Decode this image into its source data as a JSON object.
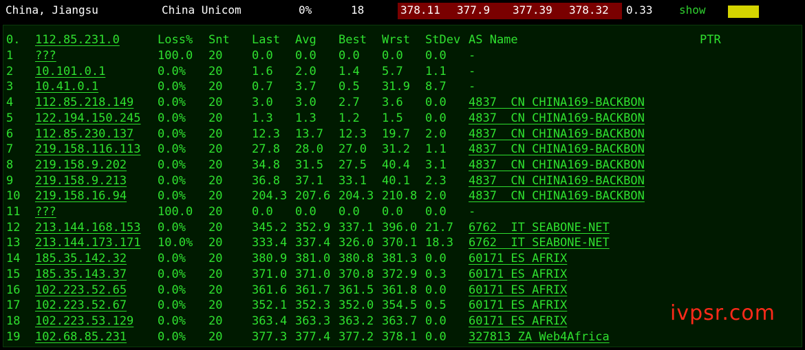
{
  "summary": {
    "location": "China, Jiangsu",
    "isp": "China Unicom",
    "loss": "0%",
    "sent": "18",
    "last": "378.11",
    "avg": "377.9",
    "best": "377.39",
    "worst": "378.32",
    "stdev": "0.33",
    "show_label": "show",
    "highlight_color": "#7a0000",
    "indicator_color": "#d4d400"
  },
  "headers": {
    "hop": "0.",
    "host": "112.85.231.0",
    "loss": "Loss%",
    "snt": "Snt",
    "last": "Last",
    "avg": "Avg",
    "best": "Best",
    "wrst": "Wrst",
    "stdev": "StDev",
    "asname": "AS Name",
    "ptr": "PTR"
  },
  "hops": [
    {
      "n": "1",
      "host": "???",
      "loss": "100.0",
      "snt": "20",
      "last": "0.0",
      "avg": "0.0",
      "best": "0.0",
      "wrst": "0.0",
      "stdev": "0.0",
      "as": "-"
    },
    {
      "n": "2",
      "host": "10.101.0.1",
      "loss": "0.0%",
      "snt": "20",
      "last": "1.6",
      "avg": "2.0",
      "best": "1.4",
      "wrst": "5.7",
      "stdev": "1.1",
      "as": "-"
    },
    {
      "n": "3",
      "host": "10.41.0.1",
      "loss": "0.0%",
      "snt": "20",
      "last": "0.7",
      "avg": "3.7",
      "best": "0.5",
      "wrst": "31.9",
      "stdev": "8.7",
      "as": "-"
    },
    {
      "n": "4",
      "host": "112.85.218.149",
      "loss": "0.0%",
      "snt": "20",
      "last": "3.0",
      "avg": "3.0",
      "best": "2.7",
      "wrst": "3.6",
      "stdev": "0.0",
      "as": "4837  CN CHINA169-BACKBON"
    },
    {
      "n": "5",
      "host": "122.194.150.245",
      "loss": "0.0%",
      "snt": "20",
      "last": "1.3",
      "avg": "1.3",
      "best": "1.2",
      "wrst": "1.5",
      "stdev": "0.0",
      "as": "4837  CN CHINA169-BACKBON"
    },
    {
      "n": "6",
      "host": "112.85.230.137",
      "loss": "0.0%",
      "snt": "20",
      "last": "12.3",
      "avg": "13.7",
      "best": "12.3",
      "wrst": "19.7",
      "stdev": "2.0",
      "as": "4837  CN CHINA169-BACKBON"
    },
    {
      "n": "7",
      "host": "219.158.116.113",
      "loss": "0.0%",
      "snt": "20",
      "last": "27.8",
      "avg": "28.0",
      "best": "27.0",
      "wrst": "31.2",
      "stdev": "1.1",
      "as": "4837  CN CHINA169-BACKBON"
    },
    {
      "n": "8",
      "host": "219.158.9.202",
      "loss": "0.0%",
      "snt": "20",
      "last": "34.8",
      "avg": "31.5",
      "best": "27.5",
      "wrst": "40.4",
      "stdev": "3.1",
      "as": "4837  CN CHINA169-BACKBON"
    },
    {
      "n": "9",
      "host": "219.158.9.213",
      "loss": "0.0%",
      "snt": "20",
      "last": "36.8",
      "avg": "37.1",
      "best": "33.1",
      "wrst": "40.1",
      "stdev": "2.3",
      "as": "4837  CN CHINA169-BACKBON"
    },
    {
      "n": "10",
      "host": "219.158.16.94",
      "loss": "0.0%",
      "snt": "20",
      "last": "204.3",
      "avg": "207.6",
      "best": "204.3",
      "wrst": "210.8",
      "stdev": "2.0",
      "as": "4837  CN CHINA169-BACKBON"
    },
    {
      "n": "11",
      "host": "???",
      "loss": "100.0",
      "snt": "20",
      "last": "0.0",
      "avg": "0.0",
      "best": "0.0",
      "wrst": "0.0",
      "stdev": "0.0",
      "as": "-"
    },
    {
      "n": "12",
      "host": "213.144.168.153",
      "loss": "0.0%",
      "snt": "20",
      "last": "345.2",
      "avg": "352.9",
      "best": "337.1",
      "wrst": "396.0",
      "stdev": "21.7",
      "as": "6762  IT SEABONE-NET"
    },
    {
      "n": "13",
      "host": "213.144.173.171",
      "loss": "10.0%",
      "snt": "20",
      "last": "333.4",
      "avg": "337.4",
      "best": "326.0",
      "wrst": "370.1",
      "stdev": "18.3",
      "as": "6762  IT SEABONE-NET"
    },
    {
      "n": "14",
      "host": "185.35.142.32",
      "loss": "0.0%",
      "snt": "20",
      "last": "380.9",
      "avg": "381.0",
      "best": "380.8",
      "wrst": "381.3",
      "stdev": "0.0",
      "as": "60171 ES AFRIX"
    },
    {
      "n": "15",
      "host": "185.35.143.37",
      "loss": "0.0%",
      "snt": "20",
      "last": "371.0",
      "avg": "371.0",
      "best": "370.8",
      "wrst": "372.9",
      "stdev": "0.3",
      "as": "60171 ES AFRIX"
    },
    {
      "n": "16",
      "host": "102.223.52.65",
      "loss": "0.0%",
      "snt": "20",
      "last": "361.6",
      "avg": "361.7",
      "best": "361.5",
      "wrst": "361.8",
      "stdev": "0.0",
      "as": "60171 ES AFRIX"
    },
    {
      "n": "17",
      "host": "102.223.52.67",
      "loss": "0.0%",
      "snt": "20",
      "last": "352.1",
      "avg": "352.3",
      "best": "352.0",
      "wrst": "354.5",
      "stdev": "0.5",
      "as": "60171 ES AFRIX"
    },
    {
      "n": "18",
      "host": "102.223.53.129",
      "loss": "0.0%",
      "snt": "20",
      "last": "363.4",
      "avg": "363.3",
      "best": "363.2",
      "wrst": "363.7",
      "stdev": "0.0",
      "as": "60171 ES AFRIX"
    },
    {
      "n": "19",
      "host": "102.68.85.231",
      "loss": "0.0%",
      "snt": "20",
      "last": "377.3",
      "avg": "377.4",
      "best": "377.2",
      "wrst": "378.1",
      "stdev": "0.0",
      "as": "327813 ZA Web4Africa"
    }
  ],
  "watermark": "ivpsr.com"
}
